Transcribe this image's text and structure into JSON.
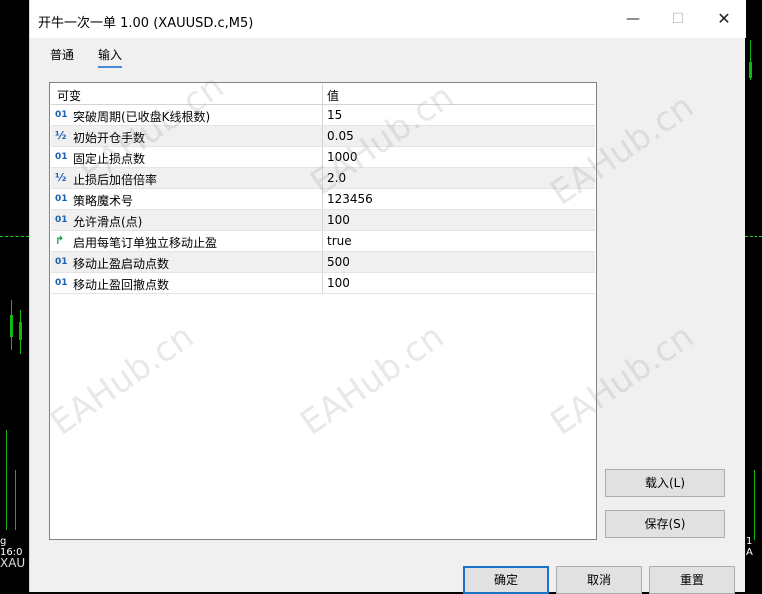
{
  "window": {
    "title": "开牛一次一单 1.00 (XAUUSD.c,M5)"
  },
  "window_controls": {
    "minimize": "—",
    "maximize": "☐",
    "close": "✕"
  },
  "tabs": [
    {
      "label": "普通"
    },
    {
      "label": "输入"
    }
  ],
  "grid": {
    "columns": {
      "variable": "可变",
      "value": "值"
    },
    "rows": [
      {
        "type": "01",
        "name": "突破周期(已收盘K线根数)",
        "value": "15"
      },
      {
        "type": "½",
        "name": "初始开仓手数",
        "value": "0.05"
      },
      {
        "type": "01",
        "name": "固定止损点数",
        "value": "1000"
      },
      {
        "type": "½",
        "name": "止损后加倍倍率",
        "value": "2.0"
      },
      {
        "type": "01",
        "name": "策略魔术号",
        "value": "123456"
      },
      {
        "type": "01",
        "name": "允许滑点(点)",
        "value": "100"
      },
      {
        "type": "↱",
        "name": "启用每笔订单独立移动止盈",
        "value": "true"
      },
      {
        "type": "01",
        "name": "移动止盈启动点数",
        "value": "500"
      },
      {
        "type": "01",
        "name": "移动止盈回撤点数",
        "value": "100"
      }
    ]
  },
  "buttons": {
    "load": "载入(L)",
    "save": "保存(S)",
    "ok": "确定",
    "cancel": "取消",
    "reset": "重置"
  },
  "watermark": "EAHub.cn",
  "background_chart": {
    "time_label_left": "g 16:0",
    "time_label_right": "1 A",
    "symbol": "XAU"
  }
}
